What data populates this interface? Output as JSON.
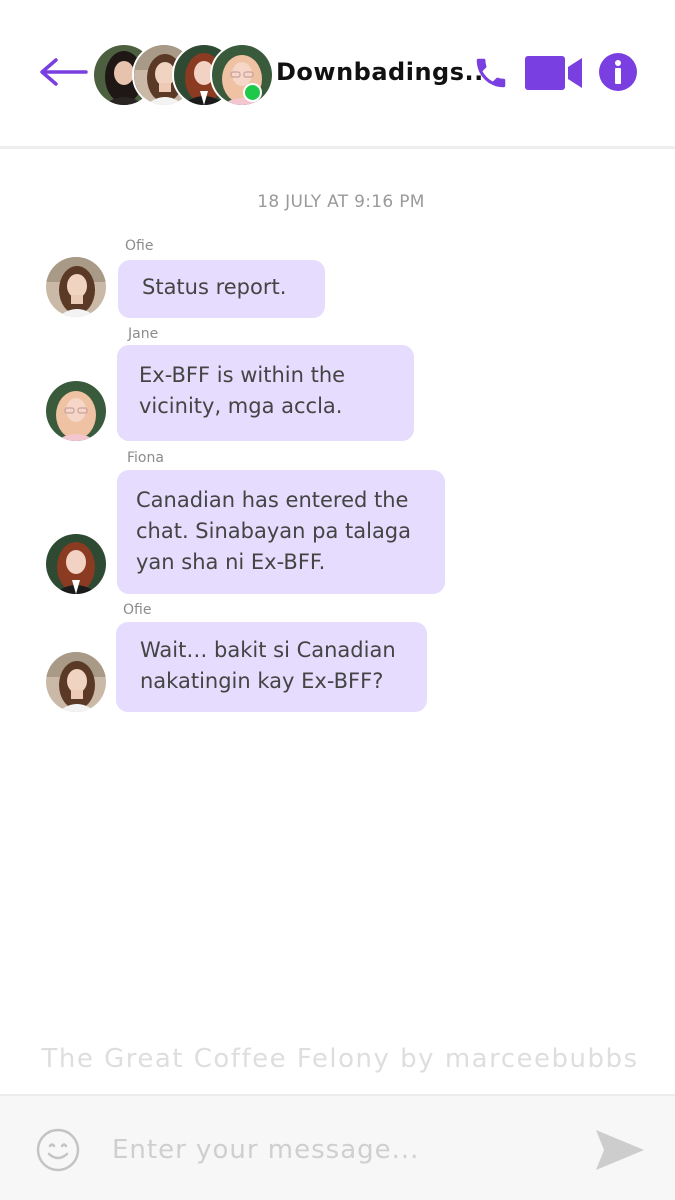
{
  "colors": {
    "accent": "#7a3fe0",
    "bubble": "#e6dcfd",
    "online": "#1ec94a"
  },
  "header": {
    "back_icon": "arrow-left-icon",
    "title": "Downbadings..",
    "call_icon": "phone-icon",
    "video_icon": "video-camera-icon",
    "info_icon": "info-icon"
  },
  "conversation": {
    "timestamp": "18 JULY AT 9:16 PM",
    "messages": [
      {
        "sender": "Ofie",
        "text": "Status report."
      },
      {
        "sender": "Jane",
        "text": "Ex-BFF is within the\nvicinity, mga accla."
      },
      {
        "sender": "Fiona",
        "text": "Canadian has entered the\nchat. Sinabayan pa talaga\nyan sha ni Ex-BFF."
      },
      {
        "sender": "Ofie",
        "text": "Wait… bakit si Canadian\nnakatingin kay Ex-BFF?"
      }
    ]
  },
  "watermark": "The Great Coffee Felony by marceebubbs",
  "composer": {
    "placeholder": "Enter your message...",
    "emoji_icon": "smiley-icon",
    "send_icon": "send-arrow-icon"
  }
}
